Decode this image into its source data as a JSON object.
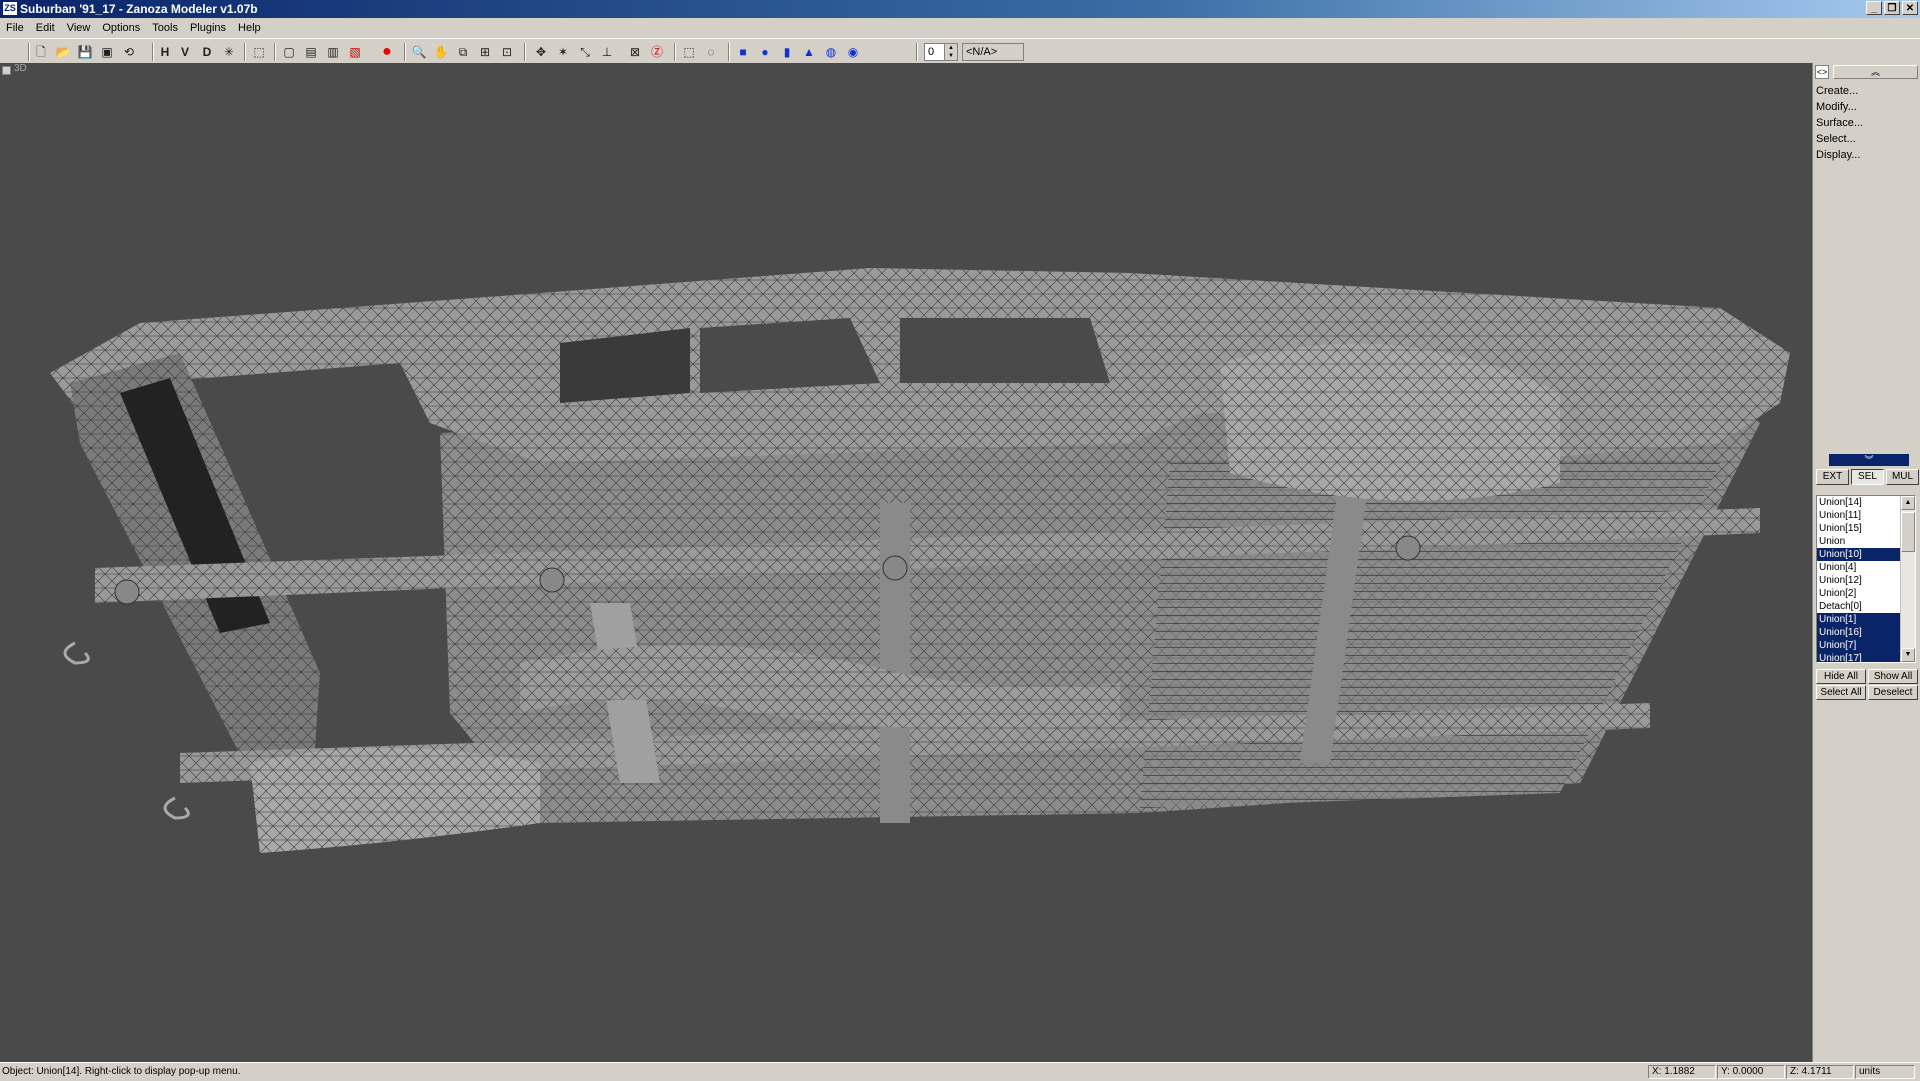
{
  "window": {
    "title": "Suburban '91_17 - Zanoza Modeler v1.07b",
    "icon_text": "ZS"
  },
  "menu": [
    "File",
    "Edit",
    "View",
    "Options",
    "Tools",
    "Plugins",
    "Help"
  ],
  "toolbar": {
    "axis_buttons": [
      "H",
      "V",
      "D"
    ],
    "spin_value": "0",
    "combo_value": "<N/A>"
  },
  "viewport": {
    "label": "3D"
  },
  "side_panel": {
    "commands": [
      "Create...",
      "Modify...",
      "Surface...",
      "Select...",
      "Display..."
    ],
    "modes": [
      "EXT",
      "SEL",
      "MUL"
    ],
    "active_mode": "SEL",
    "objects": [
      {
        "name": "Union[14]",
        "selected": false
      },
      {
        "name": "Union[11]",
        "selected": false
      },
      {
        "name": "Union[15]",
        "selected": false
      },
      {
        "name": "Union",
        "selected": false
      },
      {
        "name": "Union[10]",
        "selected": true
      },
      {
        "name": "Union[4]",
        "selected": false
      },
      {
        "name": "Union[12]",
        "selected": false
      },
      {
        "name": "Union[2]",
        "selected": false
      },
      {
        "name": "Detach[0]",
        "selected": false
      },
      {
        "name": "Union[1]",
        "selected": true
      },
      {
        "name": "Union[16]",
        "selected": true
      },
      {
        "name": "Union[7]",
        "selected": true
      },
      {
        "name": "Union[17]",
        "selected": true
      }
    ],
    "buttons": {
      "hide_all": "Hide All",
      "show_all": "Show All",
      "select_all": "Select All",
      "deselect": "Deselect"
    }
  },
  "status": {
    "message": "Object: Union[14]. Right-click to display pop-up menu.",
    "x": "X: 1.1882",
    "y": "Y: 0.0000",
    "z": "Z: 4.1711",
    "units": "units"
  }
}
